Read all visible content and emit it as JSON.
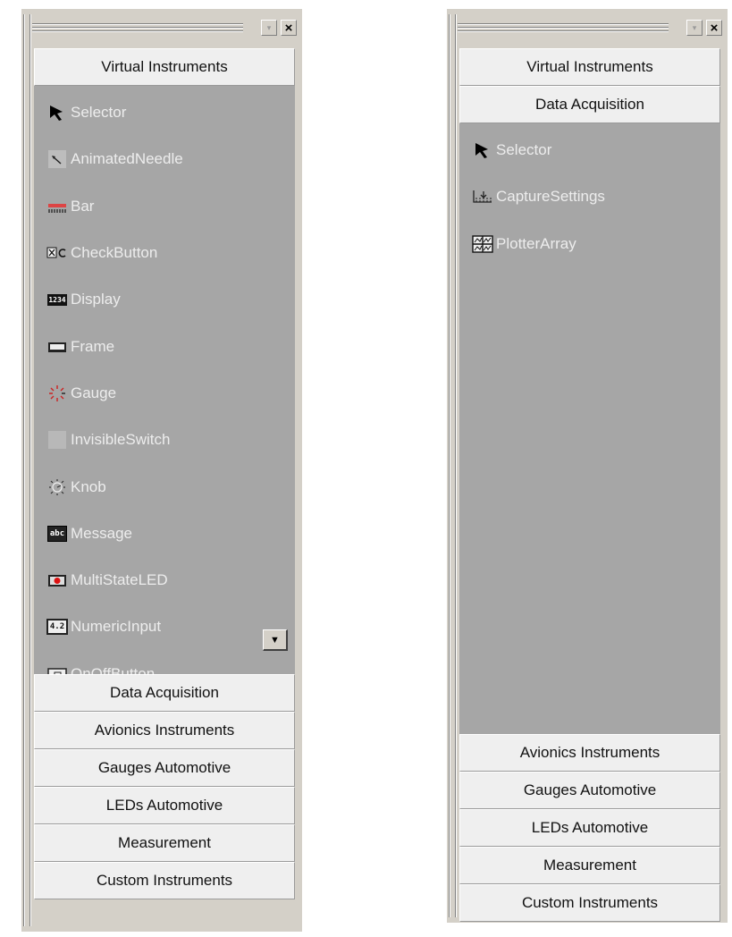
{
  "left_panel": {
    "buttons": {
      "dropdown": "▾",
      "close": "×"
    },
    "header_top": "Virtual Instruments",
    "tools": [
      {
        "label": "Selector",
        "icon": "selector-arrow-icon"
      },
      {
        "label": "AnimatedNeedle",
        "icon": "animated-needle-icon"
      },
      {
        "label": "Bar",
        "icon": "bar-icon"
      },
      {
        "label": "CheckButton",
        "icon": "check-button-icon"
      },
      {
        "label": "Display",
        "icon": "display-icon"
      },
      {
        "label": "Frame",
        "icon": "frame-icon"
      },
      {
        "label": "Gauge",
        "icon": "gauge-icon"
      },
      {
        "label": "InvisibleSwitch",
        "icon": "invisible-switch-icon"
      },
      {
        "label": "Knob",
        "icon": "knob-icon"
      },
      {
        "label": "Message",
        "icon": "message-icon"
      },
      {
        "label": "MultiStateLED",
        "icon": "multistate-led-icon"
      },
      {
        "label": "NumericInput",
        "icon": "numeric-input-icon"
      },
      {
        "label": "OnOffButton",
        "icon": "onoff-button-icon"
      }
    ],
    "scroll_down": "▼",
    "headers_bottom": [
      "Data Acquisition",
      "Avionics Instruments",
      "Gauges Automotive",
      "LEDs Automotive",
      "Measurement",
      "Custom Instruments"
    ]
  },
  "right_panel": {
    "buttons": {
      "dropdown": "▾",
      "close": "×"
    },
    "headers_top": [
      "Virtual Instruments",
      "Data Acquisition"
    ],
    "tools": [
      {
        "label": "Selector",
        "icon": "selector-arrow-icon"
      },
      {
        "label": "CaptureSettings",
        "icon": "capture-settings-icon"
      },
      {
        "label": "PlotterArray",
        "icon": "plotter-array-icon"
      }
    ],
    "headers_bottom": [
      "Avionics Instruments",
      "Gauges Automotive",
      "LEDs Automotive",
      "Measurement",
      "Custom Instruments"
    ]
  },
  "icon_glyphs": {
    "display": "1234",
    "message": "abc",
    "numeric": "4.2"
  }
}
